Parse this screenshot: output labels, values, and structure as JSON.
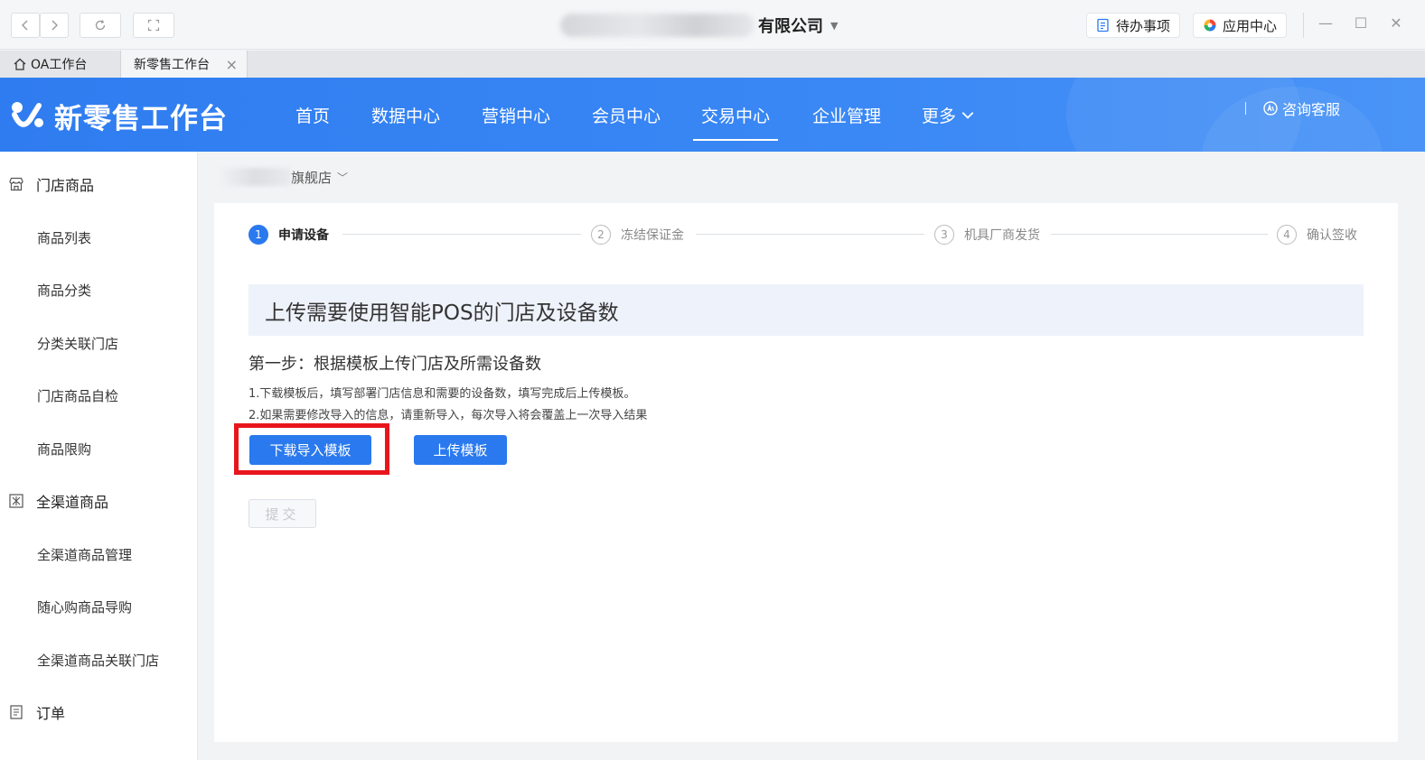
{
  "titlebar": {
    "company_suffix": "有限公司",
    "todo_label": "待办事项",
    "app_center_label": "应用中心"
  },
  "tabs": [
    {
      "label": "OA工作台"
    },
    {
      "label": "新零售工作台"
    }
  ],
  "header": {
    "brand": "新零售工作台",
    "nav": [
      {
        "label": "首页"
      },
      {
        "label": "数据中心"
      },
      {
        "label": "营销中心"
      },
      {
        "label": "会员中心"
      },
      {
        "label": "交易中心",
        "active": true
      },
      {
        "label": "企业管理"
      },
      {
        "label": "更多"
      }
    ],
    "support_label": "咨询客服",
    "colors": {
      "primary": "#2f7cf0",
      "highlight": "#e8161c"
    }
  },
  "sidebar": {
    "groups": [
      {
        "label": "门店商品",
        "icon": "store-icon"
      },
      {
        "label": "全渠道商品",
        "icon": "channel-icon"
      },
      {
        "label": "订单",
        "icon": "order-icon"
      }
    ],
    "items": [
      {
        "label": "商品列表"
      },
      {
        "label": "商品分类"
      },
      {
        "label": "分类关联门店"
      },
      {
        "label": "门店商品自检"
      },
      {
        "label": "商品限购"
      },
      {
        "label": "全渠道商品管理"
      },
      {
        "label": "随心购商品导购"
      },
      {
        "label": "全渠道商品关联门店"
      }
    ]
  },
  "content": {
    "store_suffix": "旗舰店",
    "steps": [
      {
        "num": "1",
        "label": "申请设备"
      },
      {
        "num": "2",
        "label": "冻结保证金"
      },
      {
        "num": "3",
        "label": "机具厂商发货"
      },
      {
        "num": "4",
        "label": "确认签收"
      }
    ],
    "banner": "上传需要使用智能POS的门店及设备数",
    "step_title": "第一步：根据模板上传门店及所需设备数",
    "notes": [
      "1.下载模板后，填写部署门店信息和需要的设备数，填写完成后上传模板。",
      "2.如果需要修改导入的信息，请重新导入，每次导入将会覆盖上一次导入结果"
    ],
    "download_label": "下载导入模板",
    "upload_label": "上传模板",
    "submit_label": "提交"
  }
}
